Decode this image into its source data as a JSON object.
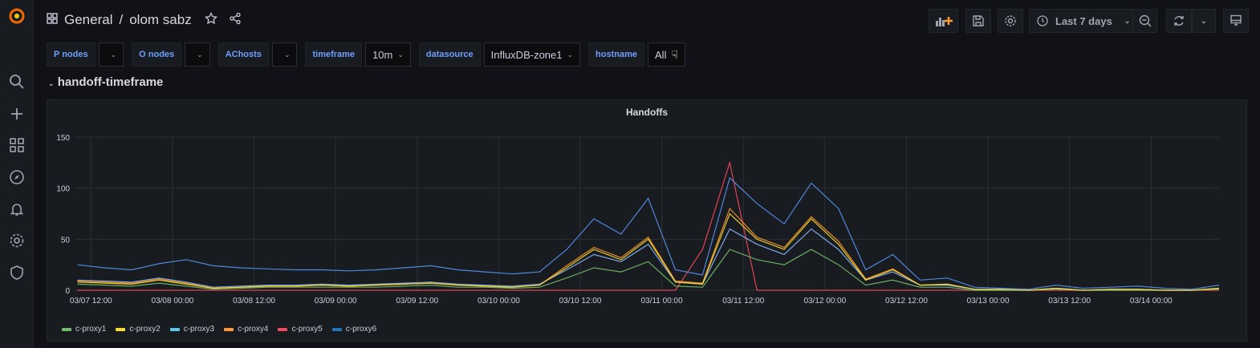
{
  "breadcrumb": {
    "folder": "General",
    "separator": "/",
    "dashboard": "olom sabz"
  },
  "toolbar": {
    "time_range": "Last 7 days"
  },
  "variables": [
    {
      "label": "P nodes",
      "value": ""
    },
    {
      "label": "O nodes",
      "value": ""
    },
    {
      "label": "AChosts",
      "value": ""
    },
    {
      "label": "timeframe",
      "value": "10m"
    },
    {
      "label": "datasource",
      "value": "InfluxDB-zone1"
    },
    {
      "label": "hostname",
      "value": "All"
    }
  ],
  "row": {
    "title": "handoff-timeframe"
  },
  "chart_data": {
    "type": "line",
    "title": "Handoffs",
    "xlabel": "",
    "ylabel": "",
    "ylim": [
      0,
      150
    ],
    "yticks": [
      0,
      50,
      100,
      150
    ],
    "x_unit": "hours since 03/07 12:00",
    "xlim": [
      -2.4,
      166
    ],
    "xticks": [
      {
        "h": 0,
        "label": "03/07 12:00"
      },
      {
        "h": 12,
        "label": "03/08 00:00"
      },
      {
        "h": 24,
        "label": "03/08 12:00"
      },
      {
        "h": 36,
        "label": "03/09 00:00"
      },
      {
        "h": 48,
        "label": "03/09 12:00"
      },
      {
        "h": 60,
        "label": "03/10 00:00"
      },
      {
        "h": 72,
        "label": "03/10 12:00"
      },
      {
        "h": 84,
        "label": "03/11 00:00"
      },
      {
        "h": 96,
        "label": "03/11 12:00"
      },
      {
        "h": 108,
        "label": "03/12 00:00"
      },
      {
        "h": 120,
        "label": "03/12 12:00"
      },
      {
        "h": 132,
        "label": "03/13 00:00"
      },
      {
        "h": 144,
        "label": "03/13 12:00"
      },
      {
        "h": 156,
        "label": "03/14 00:00"
      }
    ],
    "x_start": -2,
    "x_step": 4,
    "grid": true,
    "legend": "bottom-left",
    "series": [
      {
        "name": "c-proxy5",
        "color": "#f2495c",
        "values": [
          0,
          0,
          0,
          0,
          0,
          0,
          0,
          0,
          0,
          0,
          0,
          0,
          0,
          0,
          0,
          0,
          0,
          0,
          0,
          0,
          0,
          0,
          0,
          40,
          125,
          0,
          0,
          0,
          0,
          0,
          0,
          0,
          0,
          0,
          0,
          0,
          0,
          0,
          0,
          0,
          0,
          0,
          0
        ]
      },
      {
        "name": "c-proxy4",
        "color": "#ff9830",
        "values": [
          9,
          8,
          7,
          11,
          7,
          2,
          3,
          4,
          4,
          5,
          4,
          5,
          6,
          7,
          5,
          4,
          3,
          5,
          24,
          42,
          32,
          52,
          9,
          7,
          80,
          52,
          42,
          72,
          48,
          11,
          21,
          5,
          6,
          1,
          1,
          0,
          2,
          0,
          1,
          1,
          0,
          0,
          2
        ]
      },
      {
        "name": "c-proxy1",
        "color": "#73bf69",
        "values": [
          6,
          5,
          4,
          7,
          4,
          1,
          2,
          3,
          3,
          3,
          3,
          3,
          4,
          5,
          3,
          3,
          2,
          3,
          12,
          22,
          18,
          28,
          4,
          3,
          40,
          30,
          25,
          40,
          25,
          5,
          10,
          3,
          3,
          0,
          0,
          0,
          1,
          0,
          0,
          0,
          0,
          0,
          1
        ]
      },
      {
        "name": "c-proxy3",
        "color": "#8ab8ff",
        "values": [
          10,
          9,
          8,
          12,
          8,
          3,
          4,
          5,
          5,
          6,
          5,
          6,
          7,
          8,
          6,
          5,
          4,
          6,
          20,
          35,
          28,
          45,
          8,
          6,
          60,
          45,
          35,
          60,
          40,
          10,
          18,
          5,
          5,
          1,
          1,
          0,
          2,
          0,
          1,
          1,
          0,
          0,
          2
        ]
      },
      {
        "name": "c-proxy2",
        "color": "#fade2a",
        "values": [
          8,
          7,
          6,
          10,
          6,
          2,
          3,
          4,
          4,
          5,
          4,
          5,
          6,
          7,
          5,
          4,
          3,
          5,
          22,
          40,
          30,
          50,
          8,
          6,
          75,
          50,
          40,
          70,
          45,
          10,
          20,
          5,
          6,
          1,
          1,
          0,
          2,
          0,
          1,
          1,
          0,
          0,
          2
        ]
      },
      {
        "name": "c-proxy6",
        "color": "#5794f2",
        "values": [
          25,
          22,
          20,
          26,
          30,
          24,
          22,
          21,
          20,
          20,
          19,
          20,
          22,
          24,
          20,
          18,
          16,
          18,
          40,
          70,
          55,
          90,
          20,
          15,
          110,
          85,
          65,
          105,
          80,
          20,
          35,
          10,
          12,
          3,
          2,
          1,
          5,
          2,
          3,
          4,
          2,
          1,
          5
        ]
      }
    ],
    "legend_order": [
      {
        "name": "c-proxy1",
        "color": "#73bf69"
      },
      {
        "name": "c-proxy2",
        "color": "#fade2a"
      },
      {
        "name": "c-proxy3",
        "color": "#5ac8e8"
      },
      {
        "name": "c-proxy4",
        "color": "#ff9830"
      },
      {
        "name": "c-proxy5",
        "color": "#f2495c"
      },
      {
        "name": "c-proxy6",
        "color": "#1f78c1"
      }
    ]
  }
}
